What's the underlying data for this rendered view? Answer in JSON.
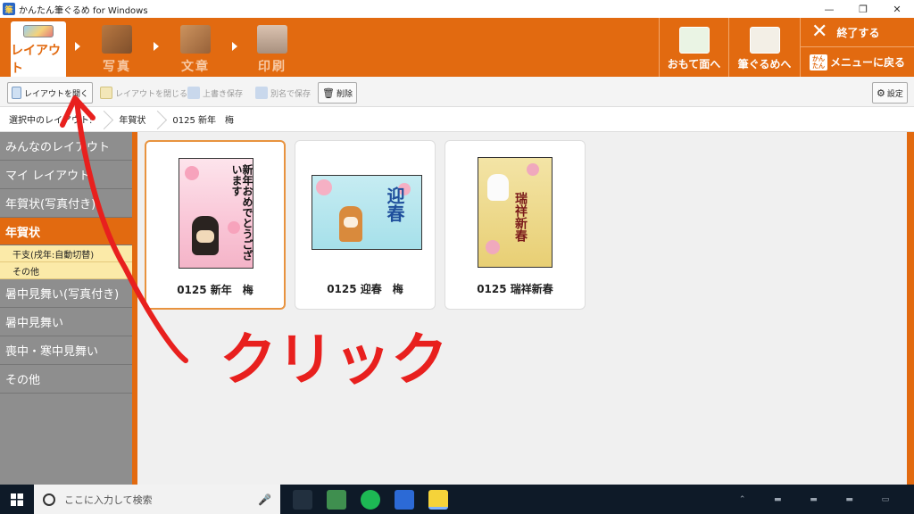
{
  "window": {
    "title": "かんたん筆ぐるめ for Windows",
    "minimize": "—",
    "maximize": "❐",
    "close": "✕"
  },
  "steps": [
    {
      "label": "レイアウト",
      "active": true
    },
    {
      "label": "写真",
      "active": false
    },
    {
      "label": "文章",
      "active": false
    },
    {
      "label": "印刷",
      "active": false
    }
  ],
  "right_buttons": {
    "front": "おもて面へ",
    "fudegurume": "筆ぐるめへ",
    "exit": "終了する",
    "menu_badge": "かんたん",
    "menu": "メニューに戻る"
  },
  "toolbar": {
    "open_layout": "レイアウトを開く",
    "close_layout": "レイアウトを閉じる",
    "overwrite_save": "上書き保存",
    "save_as": "別名で保存",
    "delete": "削除",
    "settings": "設定"
  },
  "breadcrumb": {
    "label": "選択中のレイアウト:",
    "category": "年賀状",
    "item": "0125 新年　梅"
  },
  "sidebar": {
    "items": [
      {
        "label": "みんなのレイアウト"
      },
      {
        "label": "マイ レイアウト"
      },
      {
        "label": "年賀状(写真付き)"
      },
      {
        "label": "年賀状",
        "active": true
      }
    ],
    "subitems": [
      {
        "label": "干支(戌年:自動切替)"
      },
      {
        "label": "その他"
      }
    ],
    "items_after": [
      {
        "label": "暑中見舞い(写真付き)"
      },
      {
        "label": "暑中見舞い"
      },
      {
        "label": "喪中・寒中見舞い"
      },
      {
        "label": "その他"
      }
    ]
  },
  "layouts": [
    {
      "name": "0125 新年　梅",
      "selected": true,
      "card_text": "新年おめでとうございます"
    },
    {
      "name": "0125 迎春　梅",
      "selected": false,
      "card_text": "迎春"
    },
    {
      "name": "0125 瑞祥新春",
      "selected": false,
      "card_text": "瑞祥新春"
    }
  ],
  "taskbar": {
    "search_placeholder": "ここに入力して検索"
  },
  "annotation": {
    "text": "クリック",
    "color": "#e8201e"
  },
  "colors": {
    "accent": "#e26a10",
    "sidebar": "#8e8e8e",
    "subitem": "#fbeaa8"
  }
}
